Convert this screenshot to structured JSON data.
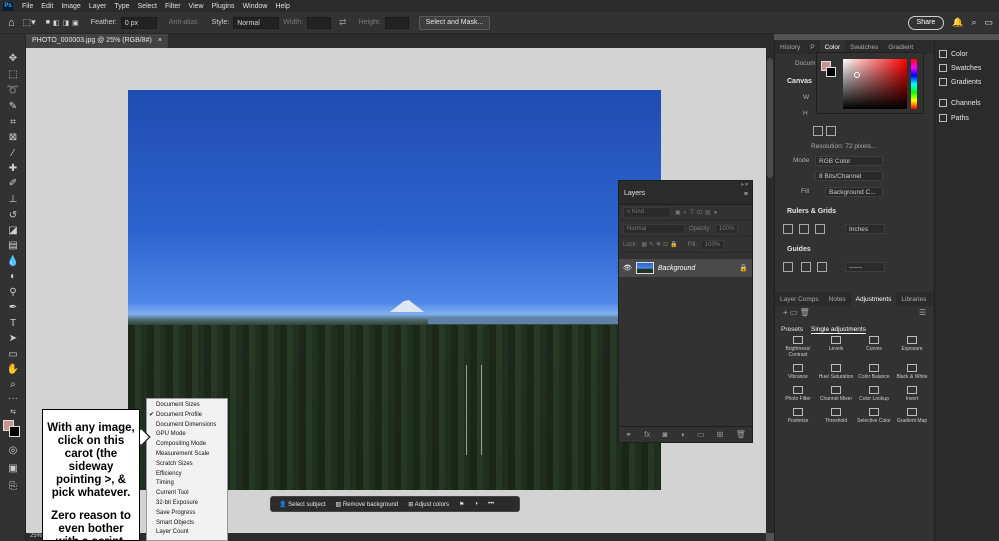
{
  "menubar": {
    "logo": "Ps",
    "items": [
      "File",
      "Edit",
      "Image",
      "Layer",
      "Type",
      "Select",
      "Filter",
      "View",
      "Plugins",
      "Window",
      "Help"
    ]
  },
  "options_bar": {
    "feather_label": "Feather:",
    "feather_value": "0 px",
    "anti_alias_label": "Anti-alias",
    "style_label": "Style:",
    "style_value": "Normal",
    "width_label": "Width:",
    "height_label": "Height:",
    "select_mask_label": "Select and Mask...",
    "share_label": "Share"
  },
  "document_tab": {
    "title": "PHOTO_000003.jpg @ 25% (RGB/8#)",
    "close": "×"
  },
  "status_bar": {
    "zoom": "25%"
  },
  "contextual_bar": {
    "select_subject": "Select subject",
    "remove_background": "Remove background",
    "adjust_colors": "Adjust colors",
    "more": "•••"
  },
  "layers_panel": {
    "title": "Layers",
    "filter_kind": "Kind",
    "blend_mode": "Normal",
    "opacity_label": "Opacity:",
    "opacity_value": "100%",
    "lock_label": "Lock:",
    "fill_label": "Fill:",
    "fill_value": "100%",
    "layer_name": "Background",
    "footer_fx": "fx"
  },
  "properties_panel": {
    "tabs": [
      "History",
      "P",
      "Color",
      "Swatches",
      "Gradient"
    ],
    "doc_label": "Docum",
    "canvas_section": "Canvas",
    "w_label": "W",
    "h_label": "H",
    "resolution": "Resolution: 72 pixels...",
    "mode_label": "Mode",
    "mode_value": "RGB Color",
    "bits_value": "8 Bits/Channel",
    "fill_label": "Fill",
    "fill_value": "Background C...",
    "rulers_section": "Rulers & Grids",
    "units_value": "Inches",
    "guides_section": "Guides"
  },
  "adjustments_panel": {
    "tabs": [
      "Layer Comps",
      "Notes",
      "Adjustments",
      "Libraries"
    ],
    "subtabs": [
      "Presets",
      "Single adjustments"
    ],
    "items": [
      "Brightness/ Contrast",
      "Levels",
      "Curves",
      "Exposure",
      "Vibrance",
      "Hue/ Saturation",
      "Color Balance",
      "Black & White",
      "Photo Filter",
      "Channel Mixer",
      "Color Lookup",
      "Invert",
      "Posterize",
      "Threshold",
      "Selective Color",
      "Gradient Map"
    ]
  },
  "far_right_panel": {
    "items": [
      "Color",
      "Swatches",
      "Gradients",
      "Channels",
      "Paths"
    ]
  },
  "status_menu": {
    "items": [
      "Document Sizes",
      "Document Profile",
      "Document Dimensions",
      "GPU Mode",
      "Compositing Mode",
      "Measurement Scale",
      "Scratch Sizes",
      "Efficiency",
      "Timing",
      "Current Tool",
      "32-bit Exposure",
      "Save Progress",
      "Smart Objects",
      "Layer Count"
    ],
    "checked_index": 1
  },
  "annotation": {
    "paragraph1": "With any image, click on this carot (the sideway pointing >, & pick whatever.",
    "paragraph2": "Zero reason to even bother with a script."
  },
  "colors": {
    "foreground": "#c99592",
    "background": "#000000",
    "accent": "#31a8ff"
  }
}
